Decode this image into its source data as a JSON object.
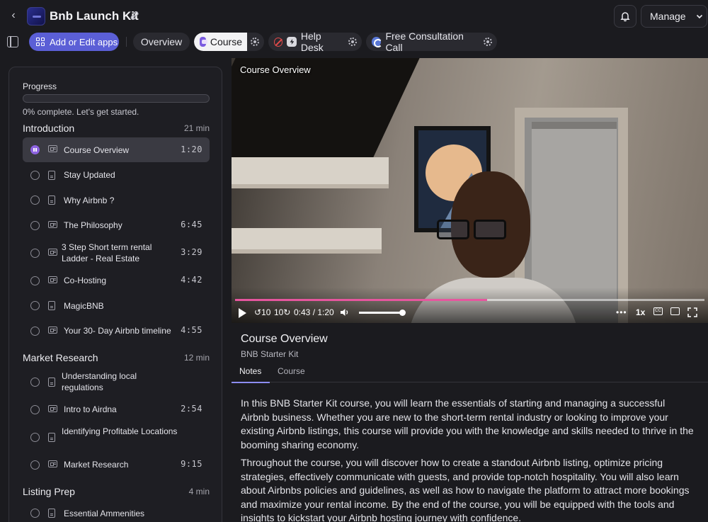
{
  "header": {
    "back_icon": "chevron-left-icon",
    "title": "Bnb Launch Kit",
    "link_icon": "link-icon",
    "manage_label": "Manage"
  },
  "tabbar": {
    "add_apps_label": "Add or Edit apps",
    "tabs": [
      {
        "label": "Overview",
        "active": false
      },
      {
        "label": "Course",
        "active": true
      },
      {
        "label": "Help Desk",
        "active": false
      },
      {
        "label": "Free Consultation Call",
        "active": false
      }
    ]
  },
  "sidebar": {
    "progress_label": "Progress",
    "progress_fraction": 0,
    "progress_text": "0% complete. Let's get started.",
    "sections": [
      {
        "title": "Introduction",
        "duration": "21 min",
        "lessons": [
          {
            "title": "Course Overview",
            "type": "video",
            "duration": "1:20",
            "active": true
          },
          {
            "title": "Stay Updated",
            "type": "document",
            "duration": ""
          },
          {
            "title": "Why Airbnb ?",
            "type": "document",
            "duration": ""
          },
          {
            "title": "The Philosophy",
            "type": "video",
            "duration": "6:45"
          },
          {
            "title": "3 Step Short term rental Ladder - Real Estate",
            "type": "video",
            "duration": "3:29"
          },
          {
            "title": "Co-Hosting",
            "type": "video",
            "duration": "4:42"
          },
          {
            "title": "MagicBNB",
            "type": "document",
            "duration": ""
          },
          {
            "title": "Your 30- Day Airbnb timeline",
            "type": "video",
            "duration": "4:55"
          }
        ]
      },
      {
        "title": "Market Research",
        "duration": "12 min",
        "lessons": [
          {
            "title": "Understanding local regulations",
            "type": "document",
            "duration": ""
          },
          {
            "title": "Intro to Airdna",
            "type": "video",
            "duration": "2:54"
          },
          {
            "title": "Identifying Profitable Locations",
            "type": "document",
            "duration": ""
          },
          {
            "title": "Market Research",
            "type": "video",
            "duration": "9:15"
          }
        ]
      },
      {
        "title": "Listing Prep",
        "duration": "4 min",
        "lessons": [
          {
            "title": "Essential Ammenities",
            "type": "document",
            "duration": ""
          }
        ]
      }
    ]
  },
  "player": {
    "overlay_title": "Course Overview",
    "skip_back_label": "10",
    "skip_forward_label": "10",
    "time_display": "0:43 / 1:20",
    "played_fraction": 0.5375,
    "volume_fraction": 0.96,
    "more_label": "•••",
    "speed_label": "1x",
    "cc_label": "CC"
  },
  "details": {
    "title": "Course Overview",
    "subtitle": "BNB Starter Kit",
    "tabs": [
      "Notes",
      "Course"
    ],
    "paragraphs": [
      "In this BNB Starter Kit course, you will learn the essentials of starting and managing a successful Airbnb business. Whether you are new to the short-term rental industry or looking to improve your existing Airbnb listings, this course will provide you with the knowledge and skills needed to thrive in the booming sharing economy.",
      "Throughout the course, you will discover how to create a standout Airbnb listing, optimize pricing strategies, effectively communicate with guests, and provide top-notch hospitality. You will also learn about Airbnbs policies and guidelines, as well as how to navigate the platform to attract more bookings and maximize your rental income. By the end of the course, you will be equipped with the tools and insights to kickstart your Airbnb hosting journey with confidence."
    ]
  },
  "colors": {
    "accent": "#5b5fd6",
    "progress_accent": "#e6569e",
    "background": "#1b1b1f"
  }
}
